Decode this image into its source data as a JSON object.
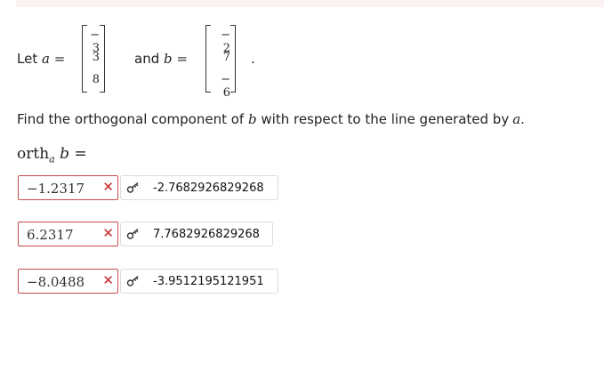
{
  "problem": {
    "let_label": "Let",
    "var_a": "a",
    "equals": "=",
    "and_label": "and",
    "var_b": "b",
    "period": ".",
    "vector_a": [
      "− 3",
      "3",
      "8"
    ],
    "vector_b": [
      "− 2",
      "7",
      "− 6"
    ],
    "question_prefix": "Find the orthogonal component of",
    "question_mid": "with respect to the line generated by",
    "question_end": ".",
    "ortho_label": "orth",
    "ortho_sub": "a",
    "ortho_var": "b",
    "ortho_eq": "="
  },
  "answers": [
    {
      "entered": "−1.2317",
      "mark": "✕",
      "correct": "-2.7682926829268"
    },
    {
      "entered": "6.2317",
      "mark": "✕",
      "correct": "7.7682926829268"
    },
    {
      "entered": "−8.0488",
      "mark": "✕",
      "correct": "-3.9512195121951"
    }
  ],
  "icons": {
    "incorrect": "x-mark-icon",
    "key": "key-icon"
  },
  "colors": {
    "error": "#c62828",
    "field_border_error": "#c74a4a",
    "banner": "#fdf1f1"
  }
}
